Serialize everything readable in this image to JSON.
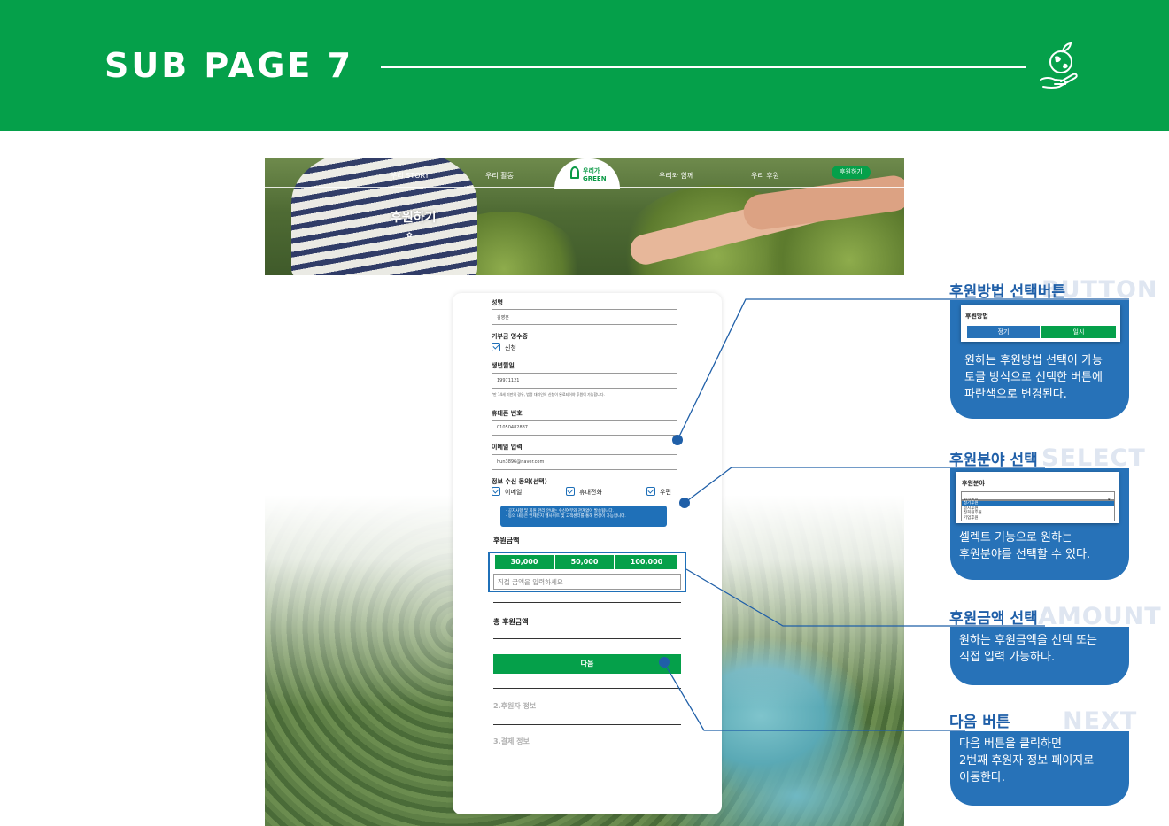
{
  "header": {
    "title": "SUB PAGE 7"
  },
  "colors": {
    "brand_green": "#05a04a",
    "accent_blue": "#1f5fa8"
  },
  "mockup": {
    "nav": {
      "items": [
        "우리 STORY",
        "우리 활동",
        "우리와 함께",
        "우리 후원"
      ],
      "logo_line1": "우리가",
      "logo_line2": "GREEN",
      "cta": "후원하기"
    },
    "hero": {
      "title": "후원하기",
      "icon": "sprout-icon"
    },
    "form": {
      "name_label": "성명",
      "name_value": "김영훈",
      "receipt_label": "기부금 영수증",
      "receipt_option": "신청",
      "birth_label": "생년월일",
      "birth_value": "19971121",
      "birth_note": "*만 14세 미만의 경우, 법정 대리인의 신청이 완료되어야 후원이 가능합니다.",
      "phone_label": "휴대폰 번호",
      "phone_value": "01050482887",
      "email_label": "이메일 입력",
      "email_value": "hun3896@naver.com",
      "consent_label": "정보 수신 동의(선택)",
      "consent_options": [
        "이메일",
        "휴대전화",
        "우편"
      ],
      "info_line1": "· 공지사항 및 회원 관리 안내는 수신여부와 관계없이 발송됩니다.",
      "info_line2": "· 동의 내용은 언제든지 웹사이트 및 고객센터를 통해 변경이 가능합니다.",
      "amount_label": "후원금액",
      "amounts": [
        "30,000",
        "50,000",
        "100,000"
      ],
      "amount_placeholder": "직접 금액을 입력하세요",
      "total_label": "총 후원금액",
      "next_label": "다음",
      "step2": "2.후원자 정보",
      "step3": "3.결제 정보"
    }
  },
  "callouts": [
    {
      "title": "후원방법 선택버튼",
      "ghost": "BUTTON",
      "preview_label": "후원방법",
      "preview_options": [
        "정기",
        "일시"
      ],
      "lines": [
        "원하는 후원방법 선택이 가능",
        "토글 방식으로 선택한 버튼에",
        "파란색으로 변경된다."
      ]
    },
    {
      "title": "후원분야 선택",
      "ghost": "SELECT",
      "preview_label": "후원분야",
      "preview_selected": "정기후원",
      "preview_options": [
        "정기후원",
        "일시후원",
        "정회원후원",
        "기업후원"
      ],
      "lines": [
        "셀렉트 기능으로 원하는",
        "후원분야를 선택할 수 있다."
      ]
    },
    {
      "title": "후원금액 선택",
      "ghost": "AMOUNT",
      "lines": [
        "원하는 후원금액을 선택 또는",
        "직접 입력 가능하다."
      ]
    },
    {
      "title": "다음 버튼",
      "ghost": "NEXT",
      "lines": [
        "다음 버튼을 클릭하면",
        "2번째 후원자 정보 페이지로",
        "이동한다."
      ]
    }
  ]
}
